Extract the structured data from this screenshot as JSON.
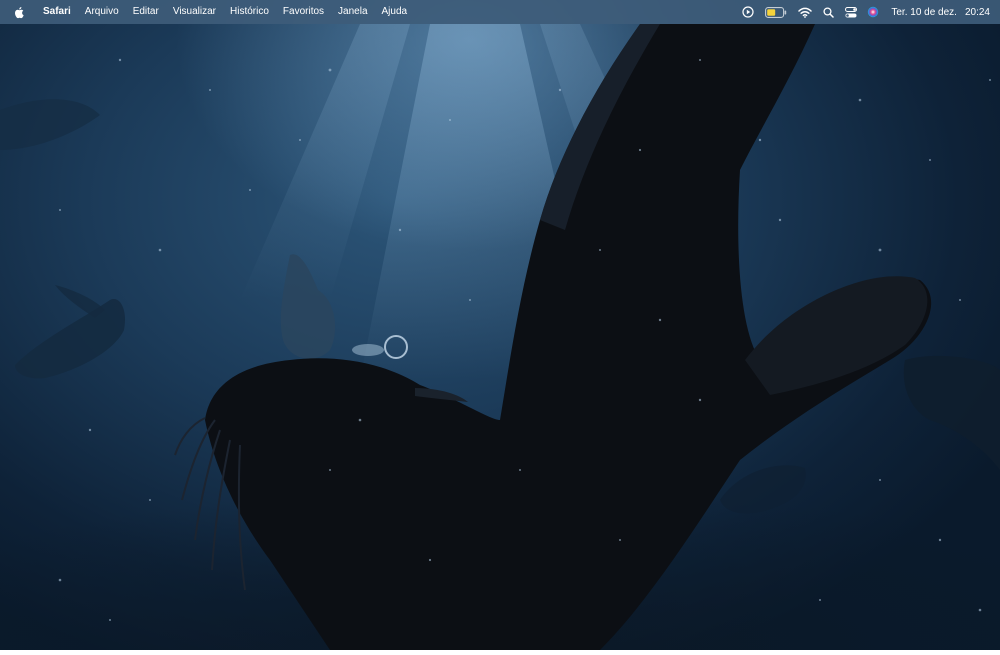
{
  "menubar": {
    "apple_icon": "apple-logo-icon",
    "items": [
      {
        "label": "Safari"
      },
      {
        "label": "Arquivo"
      },
      {
        "label": "Editar"
      },
      {
        "label": "Visualizar"
      },
      {
        "label": "Histórico"
      },
      {
        "label": "Favoritos"
      },
      {
        "label": "Janela"
      },
      {
        "label": "Ajuda"
      }
    ],
    "status_icons": [
      "now-playing-icon",
      "battery-icon",
      "wifi-icon",
      "spotlight-search-icon",
      "control-center-icon",
      "siri-icon"
    ],
    "date": "Ter. 10 de dez.",
    "time": "20:24"
  },
  "desktop": {
    "wallpaper": "underwater-sea-lions",
    "colors": {
      "deep": "#0a1a2c",
      "mid": "#1b3a58",
      "light": "#5a8cb8",
      "animal": "#0c0f14"
    }
  }
}
